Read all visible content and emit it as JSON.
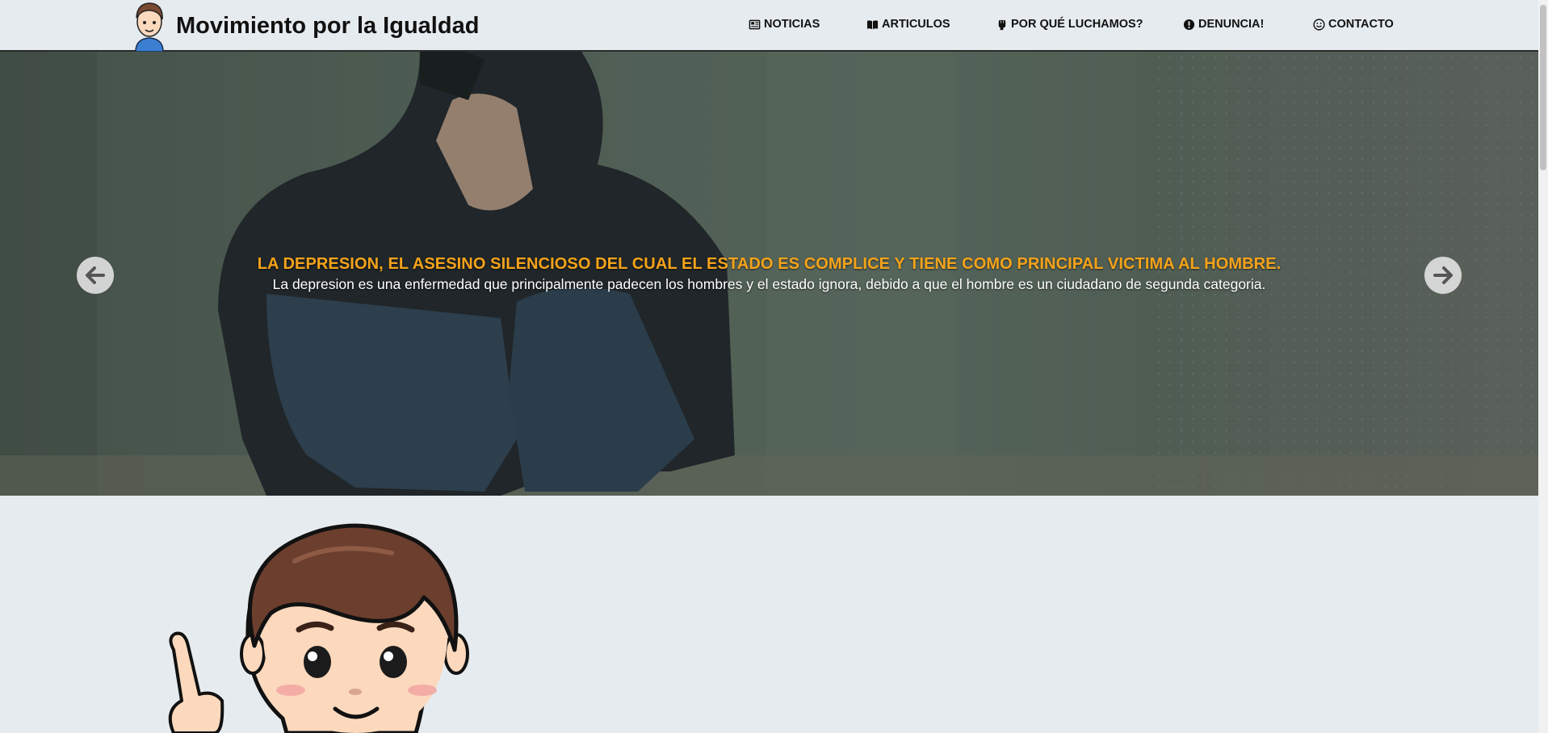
{
  "site": {
    "title": "Movimiento por la Igualdad"
  },
  "nav": {
    "items": [
      {
        "label": "NOTICIAS",
        "icon": "newspaper-icon"
      },
      {
        "label": "ARTICULOS",
        "icon": "book-open-icon"
      },
      {
        "label": "POR QUÉ LUCHAMOS?",
        "icon": "fist-icon"
      },
      {
        "label": "DENUNCIA!",
        "icon": "exclamation-circle-icon"
      },
      {
        "label": "CONTACTO",
        "icon": "smile-icon"
      }
    ]
  },
  "hero": {
    "title": "LA DEPRESION, EL ASESINO SILENCIOSO DEL CUAL EL ESTADO ES COMPLICE Y TIENE COMO PRINCIPAL VICTIMA AL HOMBRE.",
    "text": "La depresion es una enfermedad que principalmente padecen los hombres y el estado ignora, debido a que el hombre es un ciudadano de segunda categoria.",
    "prev_icon": "arrow-left-icon",
    "next_icon": "arrow-right-icon"
  },
  "colors": {
    "page_bg": "#e6ebef",
    "accent_title": "#f5a31a",
    "header_border": "#2b2b2b"
  }
}
